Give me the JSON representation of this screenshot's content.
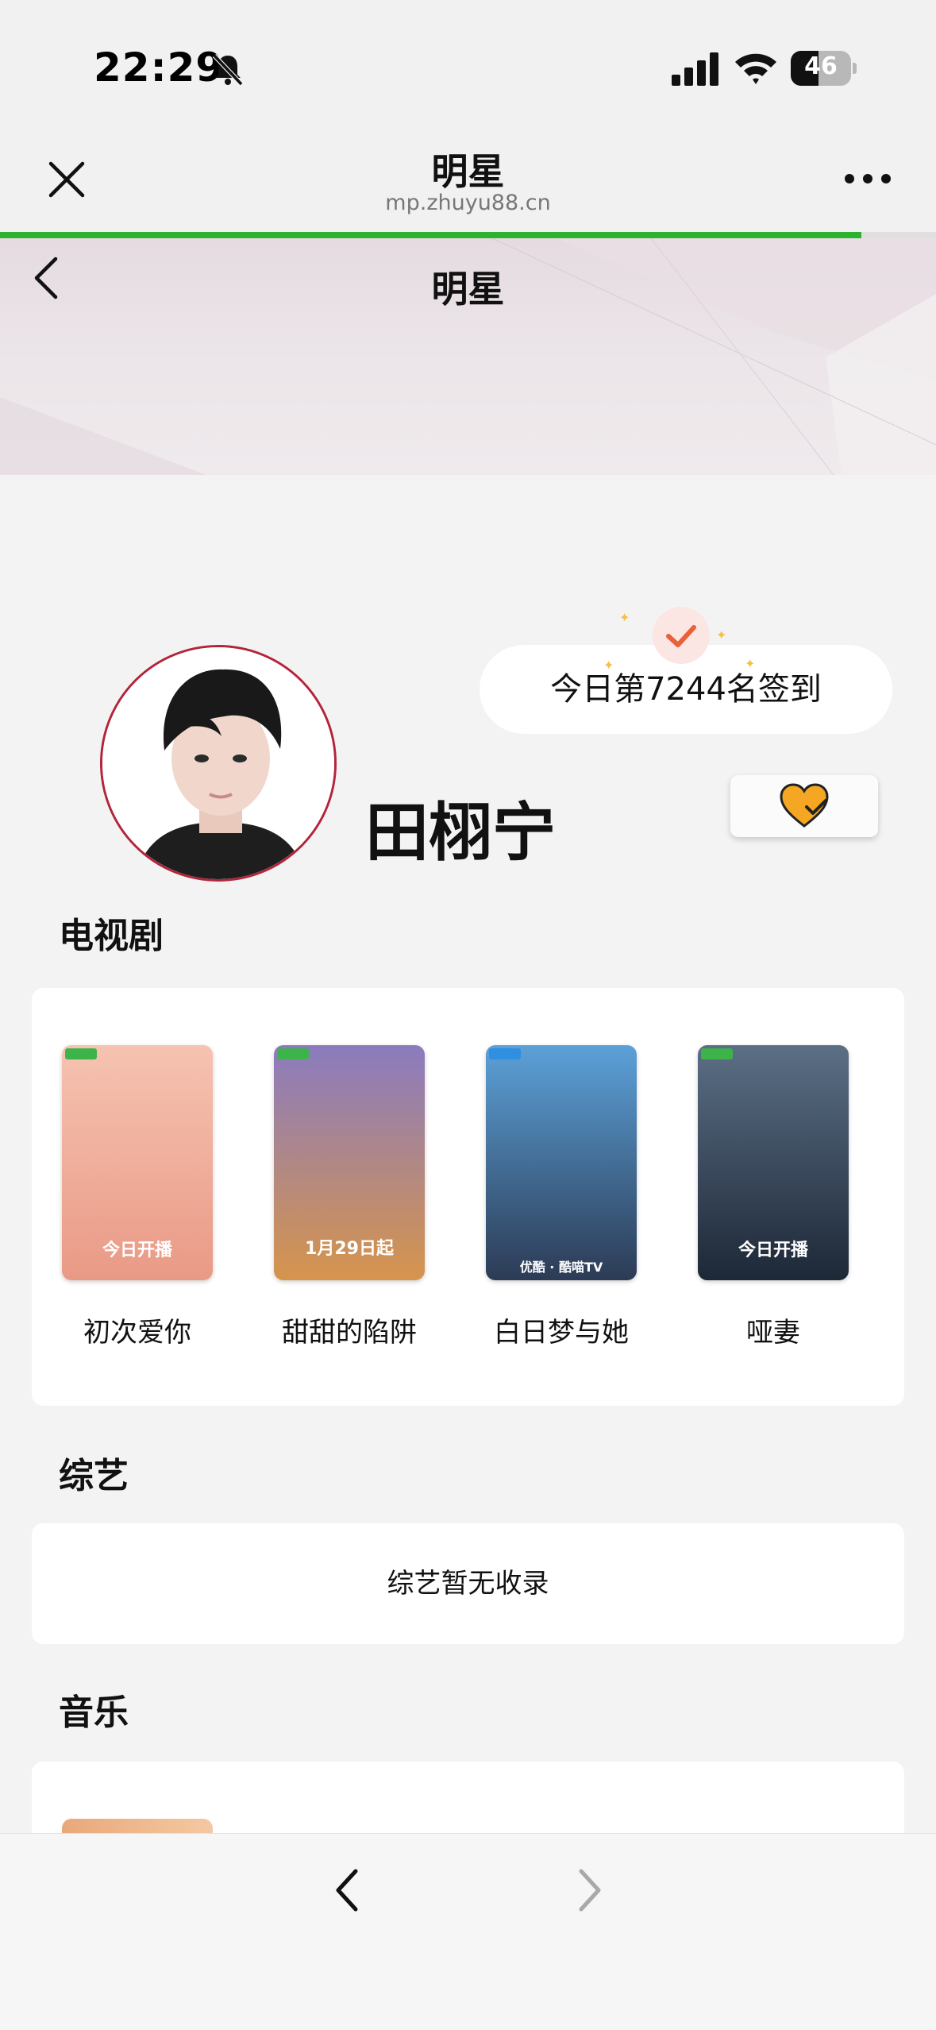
{
  "status_bar": {
    "time": "22:29",
    "battery_level": "46",
    "battery_fraction": 0.46
  },
  "browser": {
    "title": "明星",
    "url": "mp.zhuyu88.cn",
    "load_progress": 0.92
  },
  "page": {
    "title": "明星"
  },
  "profile": {
    "name": "田栩宁",
    "checkin_text": "今日第7244名签到"
  },
  "sections": {
    "tv": {
      "title": "电视剧",
      "items": [
        {
          "title": "初次爱你",
          "poster_caption": "今日开播",
          "colors": [
            "#f6c3b1",
            "#e99a86"
          ]
        },
        {
          "title": "甜甜的陷阱",
          "poster_caption": "1月29日起",
          "colors": [
            "#8a7bbf",
            "#d6944c"
          ]
        },
        {
          "title": "白日梦与她",
          "poster_caption": "优酷 · 酷喵TV",
          "colors": [
            "#5ca1d9",
            "#2c3b55"
          ]
        },
        {
          "title": "哑妻",
          "poster_caption": "今日开播",
          "colors": [
            "#5b6f85",
            "#1d2837"
          ]
        }
      ]
    },
    "variety": {
      "title": "综艺",
      "empty_text": "综艺暂无收录"
    },
    "music": {
      "title": "音乐"
    }
  },
  "colors": {
    "progress": "#2bb330",
    "avatar_border": "#b3243a",
    "heart": "#f5a623",
    "check": "#e8613b"
  },
  "icons": {
    "close": "close-icon",
    "more": "more-icon",
    "back": "chevron-left-icon",
    "favorite": "heart-check-icon",
    "checkin": "checkmark-icon",
    "nav_back": "chevron-left-icon",
    "nav_forward": "chevron-right-icon"
  }
}
